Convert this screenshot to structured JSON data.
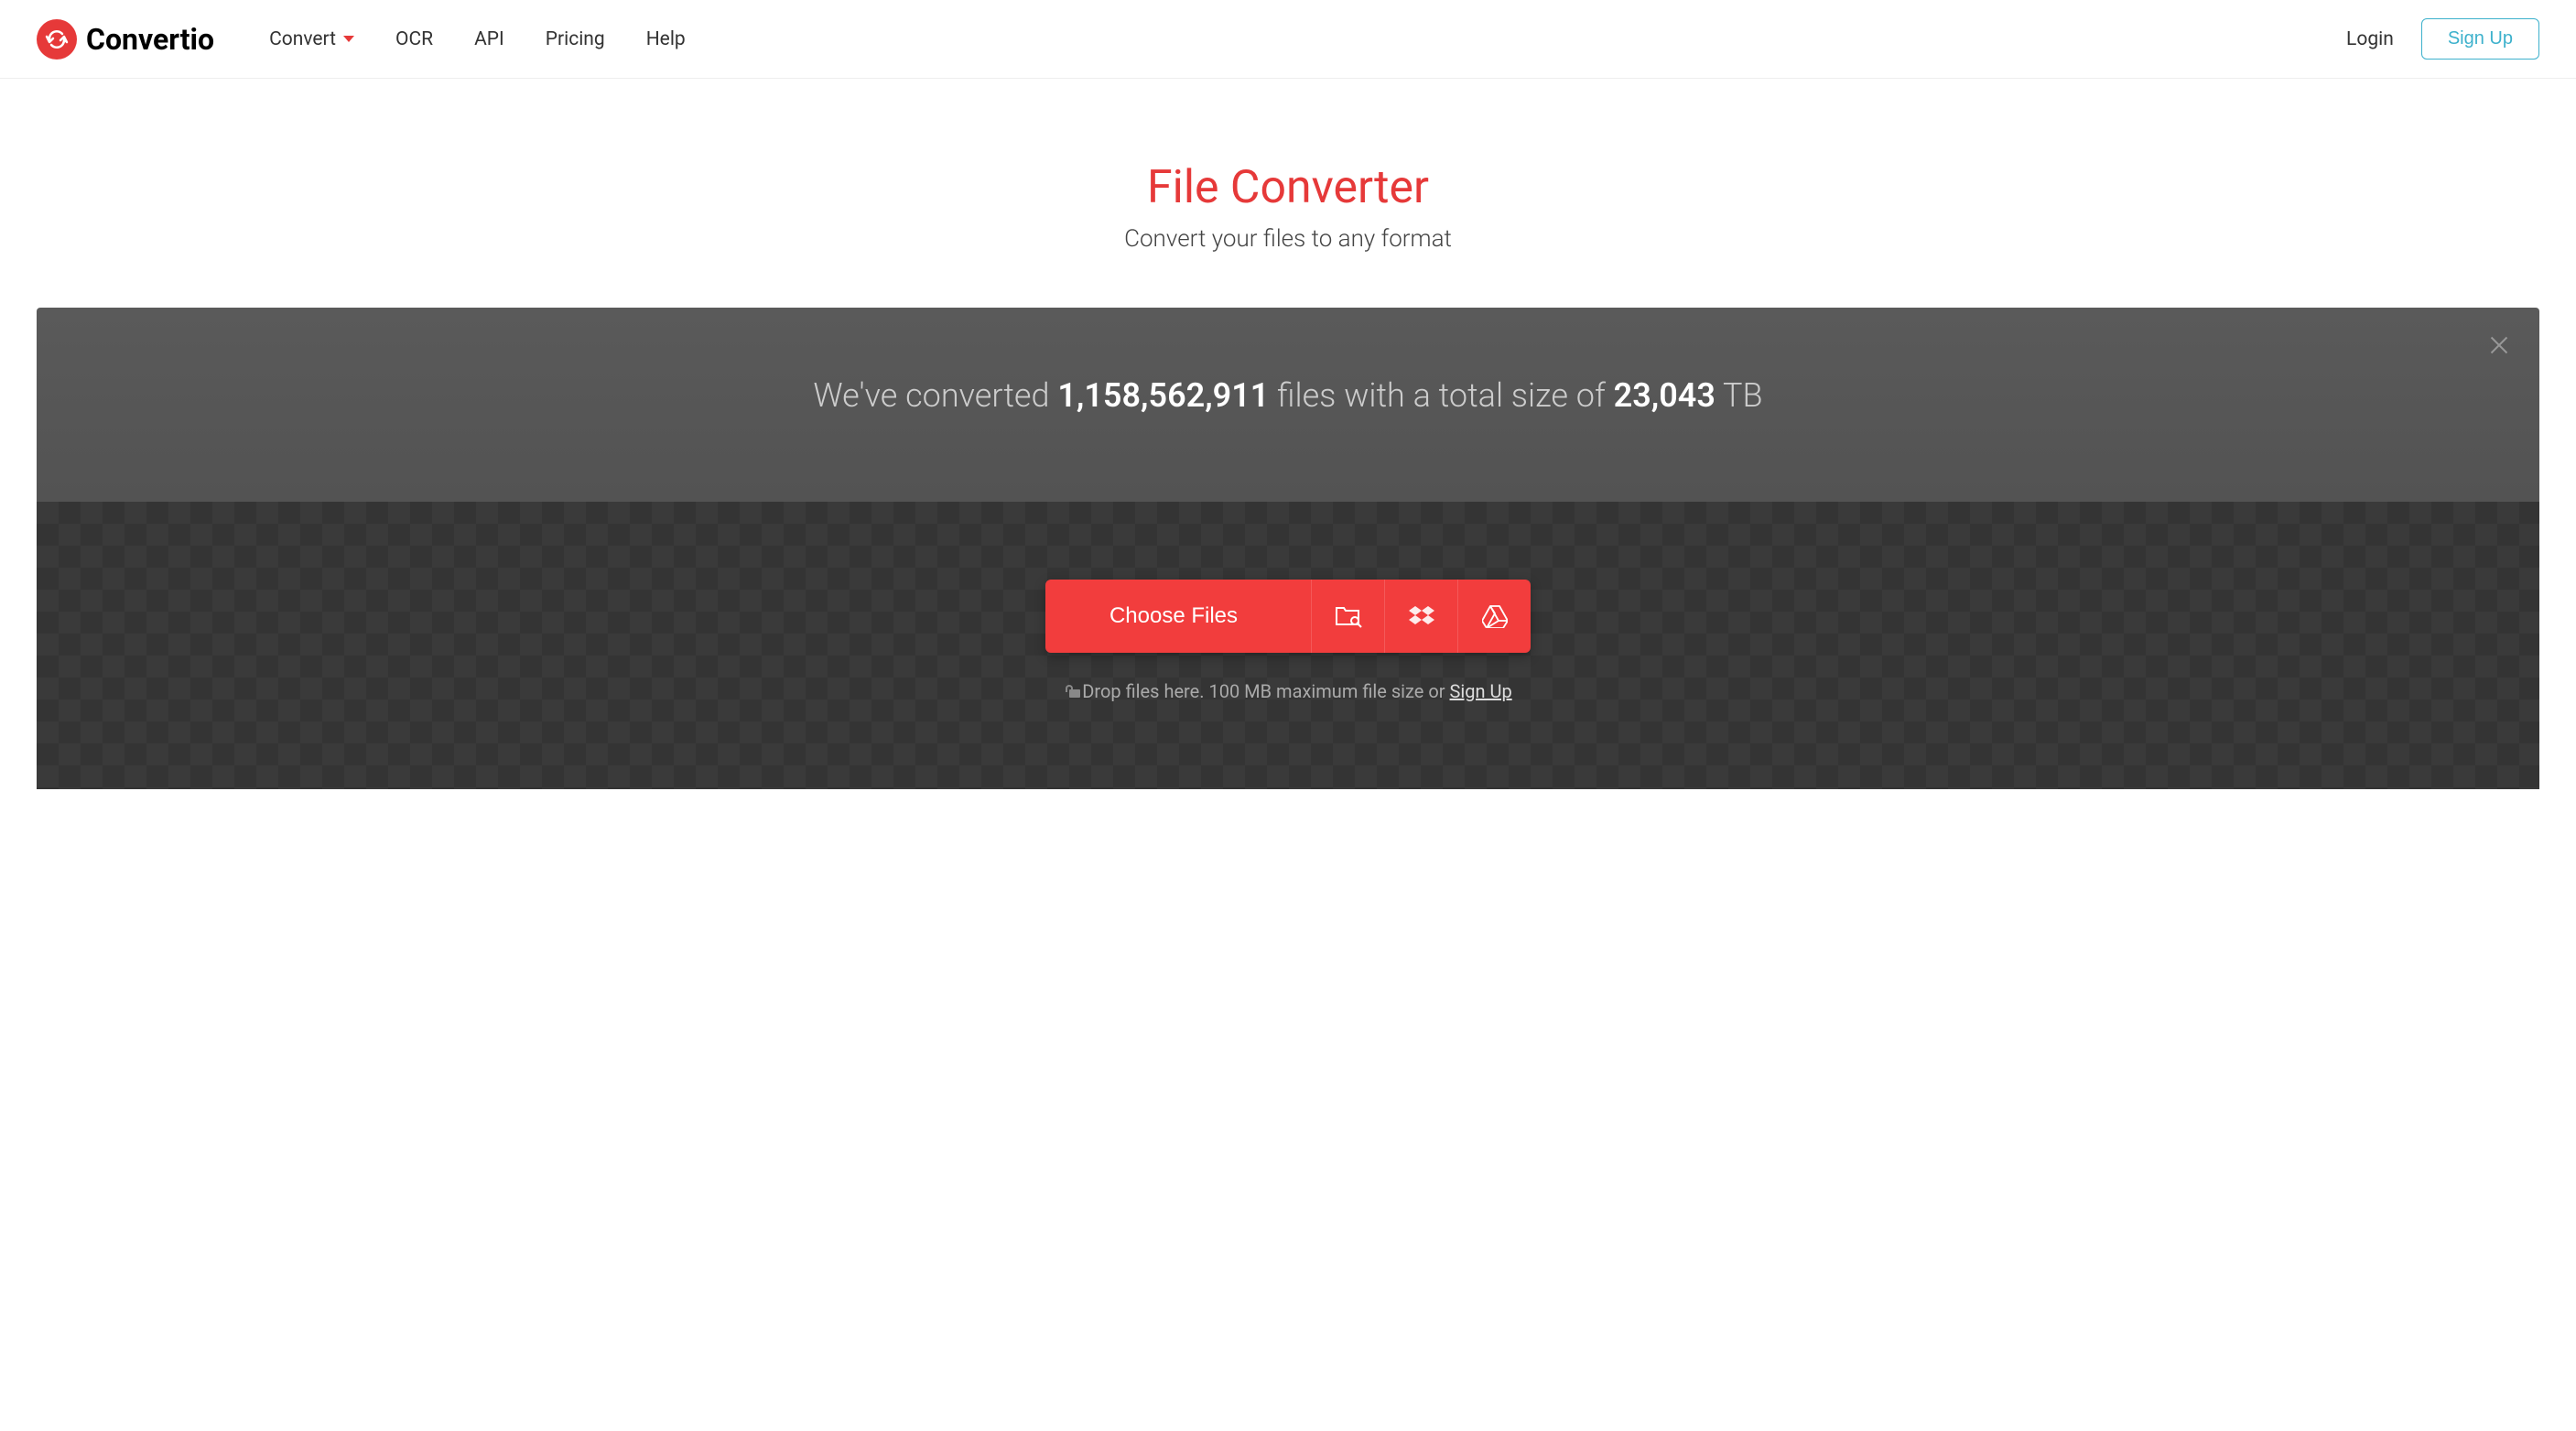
{
  "header": {
    "logo_text": "Convertio",
    "nav": {
      "convert": "Convert",
      "ocr": "OCR",
      "api": "API",
      "pricing": "Pricing",
      "help": "Help"
    },
    "auth": {
      "login": "Login",
      "signup": "Sign Up"
    }
  },
  "hero": {
    "title": "File Converter",
    "subtitle": "Convert your files to any format"
  },
  "stats": {
    "prefix": "We've converted ",
    "files_count": "1,158,562,911",
    "middle": " files with a total size of ",
    "size": "23,043",
    "size_unit": " TB"
  },
  "upload": {
    "button_label": "Choose Files",
    "drop_prefix": "Drop files here. 100 MB maximum file size or ",
    "signup_link": "Sign Up"
  }
}
